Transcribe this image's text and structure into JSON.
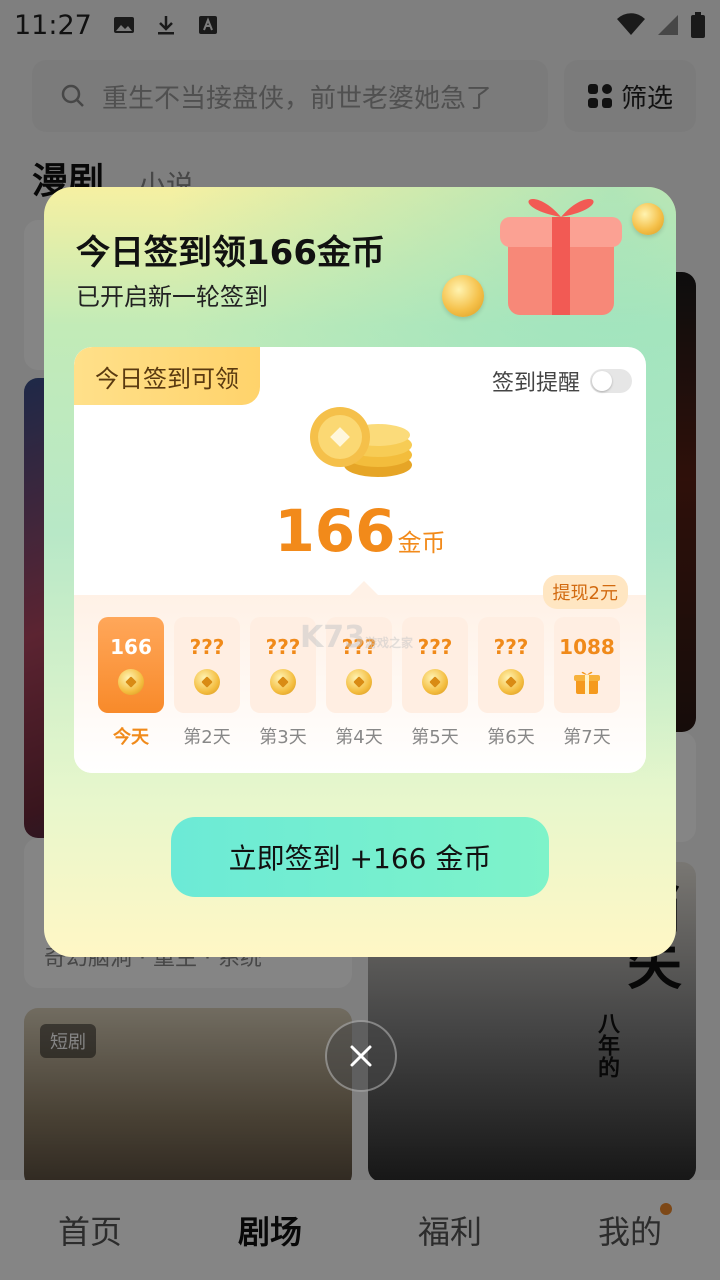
{
  "status_bar": {
    "time": "11:27"
  },
  "search": {
    "placeholder": "重生不当接盘侠，前世老婆她急了"
  },
  "filter": {
    "label": "筛选"
  },
  "top_tabs": [
    {
      "label": "漫剧"
    },
    {
      "label": "小说"
    }
  ],
  "cards": {
    "card_info_tags": "奇幻脑洞 · 重生 · 系统",
    "short_drama_tag": "短剧",
    "poster_title": "消失",
    "poster_subtitle": "八年的"
  },
  "bottom_nav": [
    {
      "label": "首页"
    },
    {
      "label": "剧场"
    },
    {
      "label": "福利"
    },
    {
      "label": "我的"
    }
  ],
  "checkin_modal": {
    "title": "今日签到领166金币",
    "subtitle": "已开启新一轮签到",
    "badge": "今日签到可领",
    "reminder_label": "签到提醒",
    "reminder_enabled": false,
    "amount": "166",
    "amount_unit": "金币",
    "withdraw_tag": "提现2元",
    "days": [
      {
        "amount": "166",
        "label": "今天",
        "icon": "coin-icon"
      },
      {
        "amount": "???",
        "label": "第2天",
        "icon": "coin-icon"
      },
      {
        "amount": "???",
        "label": "第3天",
        "icon": "coin-icon"
      },
      {
        "amount": "???",
        "label": "第4天",
        "icon": "coin-icon"
      },
      {
        "amount": "???",
        "label": "第5天",
        "icon": "coin-icon"
      },
      {
        "amount": "???",
        "label": "第6天",
        "icon": "coin-icon"
      },
      {
        "amount": "1088",
        "label": "第7天",
        "icon": "gift-icon"
      }
    ],
    "cta_label": "立即签到 +166 金币"
  },
  "watermark": {
    "text": "K73",
    "sub": "游戏之家"
  },
  "colors": {
    "accent_orange": "#f28a1a",
    "cta_green": "#6cead6",
    "modal_top": "#f6f0a2"
  }
}
